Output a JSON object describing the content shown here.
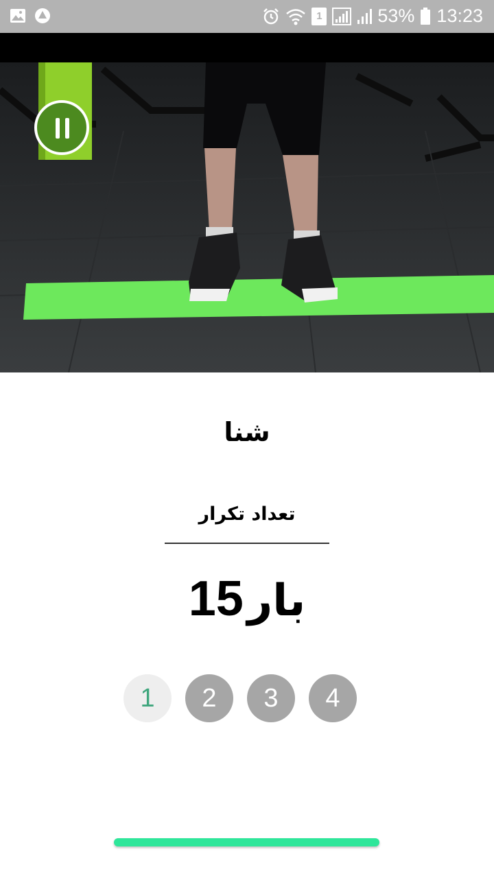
{
  "status_bar": {
    "battery": "53%",
    "time": "13:23",
    "sim_slot": "1",
    "icons": [
      "image-icon",
      "drive-icon",
      "alarm-icon",
      "wifi-icon",
      "signal-icon",
      "battery-icon"
    ]
  },
  "video": {
    "control_icon": "pause-icon",
    "accent_color": "#4c8a1f"
  },
  "exercise": {
    "title": "شنا",
    "reps_label": "تعداد تکرار",
    "reps_count": "15",
    "reps_unit": "بار"
  },
  "sets": [
    {
      "label": "1",
      "active": true
    },
    {
      "label": "2",
      "active": false
    },
    {
      "label": "3",
      "active": false
    },
    {
      "label": "4",
      "active": false
    }
  ],
  "progress_color": "#2ee69a"
}
